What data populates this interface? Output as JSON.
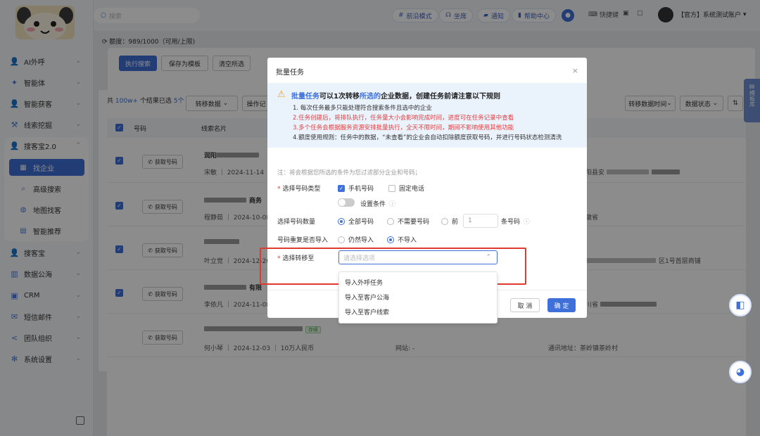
{
  "sidebar": {
    "items": [
      {
        "label": "AI外呼",
        "icon": "phone-person-icon"
      },
      {
        "label": "智能体",
        "icon": "sparkle-icon"
      },
      {
        "label": "智能获客",
        "icon": "user-icon"
      },
      {
        "label": "线索挖掘",
        "icon": "pick-icon"
      },
      {
        "label": "搜客宝2.0",
        "icon": "user-search-icon"
      }
    ],
    "sub_items": [
      {
        "label": "找企业",
        "icon": "building-icon"
      },
      {
        "label": "高级搜索",
        "icon": "search-icon"
      },
      {
        "label": "地图找客",
        "icon": "globe-icon"
      },
      {
        "label": "智能推荐",
        "icon": "recommend-icon"
      }
    ],
    "items_after": [
      {
        "label": "搜客宝",
        "icon": "user-icon"
      },
      {
        "label": "数据公海",
        "icon": "data-icon"
      },
      {
        "label": "CRM",
        "icon": "crm-icon"
      },
      {
        "label": "短信邮件",
        "icon": "mail-icon"
      },
      {
        "label": "团队组织",
        "icon": "team-icon"
      },
      {
        "label": "系统设置",
        "icon": "settings-icon"
      }
    ]
  },
  "topbar": {
    "search_placeholder": "搜索",
    "pill_frontier": "前沿模式",
    "pill_seat": "坐席",
    "pill_notice": "通知",
    "pill_help": "帮助中心",
    "shortcut": "快捷键",
    "account": "【官方】系统测试账户"
  },
  "quota": "额度：989/1000（可用/上限)",
  "filter": {
    "exec_search": "执行搜索",
    "save_template": "保存为模板",
    "clear": "清空所选"
  },
  "list": {
    "summary_prefix": "共",
    "summary_count": "100w+",
    "summary_mid": "个结果已选",
    "summary_sel": "5个",
    "transfer": "转移数据",
    "operation": "操作记",
    "sort_time": "转移数据时间",
    "data_status": "数据状态",
    "col_number": "号码",
    "col_name": "线索名片",
    "get_number": "获取号码",
    "rows": [
      {
        "title": "润阳",
        "contact": "宋敏",
        "date": "2024-11-14",
        "extra": "阳县安"
      },
      {
        "title": "商务",
        "contact": "程静茹",
        "date": "2024-10-08",
        "extra": "徽省"
      },
      {
        "title": "",
        "contact": "叶立觉",
        "date": "2024-12-20",
        "extra": "区1号首层商铺"
      },
      {
        "title": "有限",
        "contact": "李依凡",
        "date": "2024-11-08",
        "extra": "川省"
      },
      {
        "title": "",
        "contact": "何小琴",
        "date": "2024-12-03",
        "capital": "10万人民币",
        "website": "网站: -",
        "address": "通讯地址：茶岭镇茶岭村",
        "badge": "存续"
      }
    ]
  },
  "modal": {
    "title": "批量任务",
    "notice_title_a": "批量任务",
    "notice_title_b": "可以1次转移",
    "notice_title_c": "所选的",
    "notice_title_d": "企业数据，创建任务前请注意以下规则",
    "rules": [
      "1. 每次任务最多只能处理符合搜索条件且选中的企业",
      "2.任务创建后，将排队执行，任务量大小会影响完成时间，进度可在任务记录中查看",
      "3.多个任务会根据服务资源安排批量执行，全天不限时间，期间不影响使用其他功能",
      "4.额度使用规则：任务中的数据，“未查看”的企业会自动扣除额度获取号码，并进行号码状态检测清洗"
    ],
    "note": "注：将会根据您所选的条件为您过滤部分企业和号码；",
    "phone_type_label": "选择号码类型",
    "mobile": "手机号码",
    "landline": "固定电话",
    "set_condition": "设置条件",
    "count_label": "选择号码数量",
    "all_numbers": "全部号码",
    "no_numbers": "不需要号码",
    "first": "前",
    "first_value": "1",
    "per_unit": "条号码",
    "dup_label": "号码重复是否导入",
    "still_import": "仍然导入",
    "no_import": "不导入",
    "transfer_label": "选择转移至",
    "select_placeholder": "请选择选项",
    "options": [
      "导入外呼任务",
      "导入至客户公海",
      "导入至客户线索"
    ],
    "cancel": "取 消",
    "confirm": "确 定"
  },
  "float_panel": "模板库",
  "colors": {
    "accent": "#3f6fd8",
    "danger": "#e03a2f",
    "warn": "#f0a020",
    "notice_bg": "#eaf2fc"
  }
}
